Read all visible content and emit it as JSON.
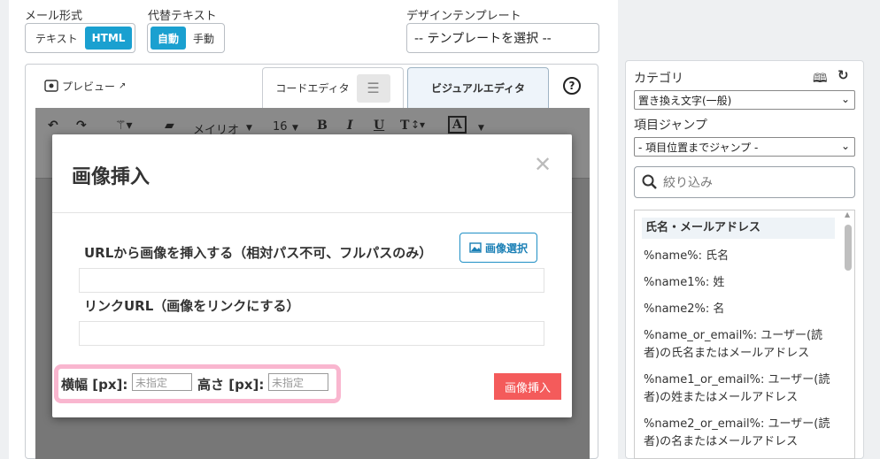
{
  "mail_format": {
    "label": "メール形式",
    "options": [
      "テキスト",
      "HTML"
    ],
    "selected": "HTML"
  },
  "alt_text": {
    "label": "代替テキスト",
    "options": [
      "自動",
      "手動"
    ],
    "selected": "自動"
  },
  "design_template": {
    "label": "デザインテンプレート",
    "value": "-- テンプレートを選択 --"
  },
  "tabs": {
    "preview": "プレビュー",
    "code_editor": "コードエディタ",
    "visual_editor": "ビジュアルエディタ",
    "help": "?"
  },
  "toolbar": {
    "font": "メイリオ",
    "size": "16",
    "bold": "B",
    "italic": "I",
    "underline": "U",
    "text": "T",
    "color": "A"
  },
  "modal": {
    "title": "画像挿入",
    "url_label": "URLから画像を挿入する（相対パス不可、フルパスのみ）",
    "image_select_button": "画像選択",
    "link_label": "リンクURL（画像をリンクにする）",
    "width_label": "横幅 [px]:",
    "width_placeholder": "未指定",
    "height_label": "高さ [px]:",
    "height_placeholder": "未指定",
    "insert_button": "画像挿入"
  },
  "sidebar": {
    "category_label": "カテゴリ",
    "category_value": "置き換え文字(一般)",
    "jump_label": "項目ジャンプ",
    "jump_value": "- 項目位置までジャンプ -",
    "search_placeholder": "絞り込み",
    "list_header": "氏名・メールアドレス",
    "items": [
      "%name%: 氏名",
      "%name1%: 姓",
      "%name2%: 名",
      "%name_or_email%: ユーザー(読者)の氏名またはメールアドレス",
      "%name1_or_email%: ユーザー(読者)の姓またはメールアドレス",
      "%name2_or_email%: ユーザー(読者)の名またはメールアドレス"
    ]
  },
  "colors": {
    "accent": "#1aa0d0",
    "insert": "#f45b5b",
    "highlight": "#f9b6cf"
  }
}
